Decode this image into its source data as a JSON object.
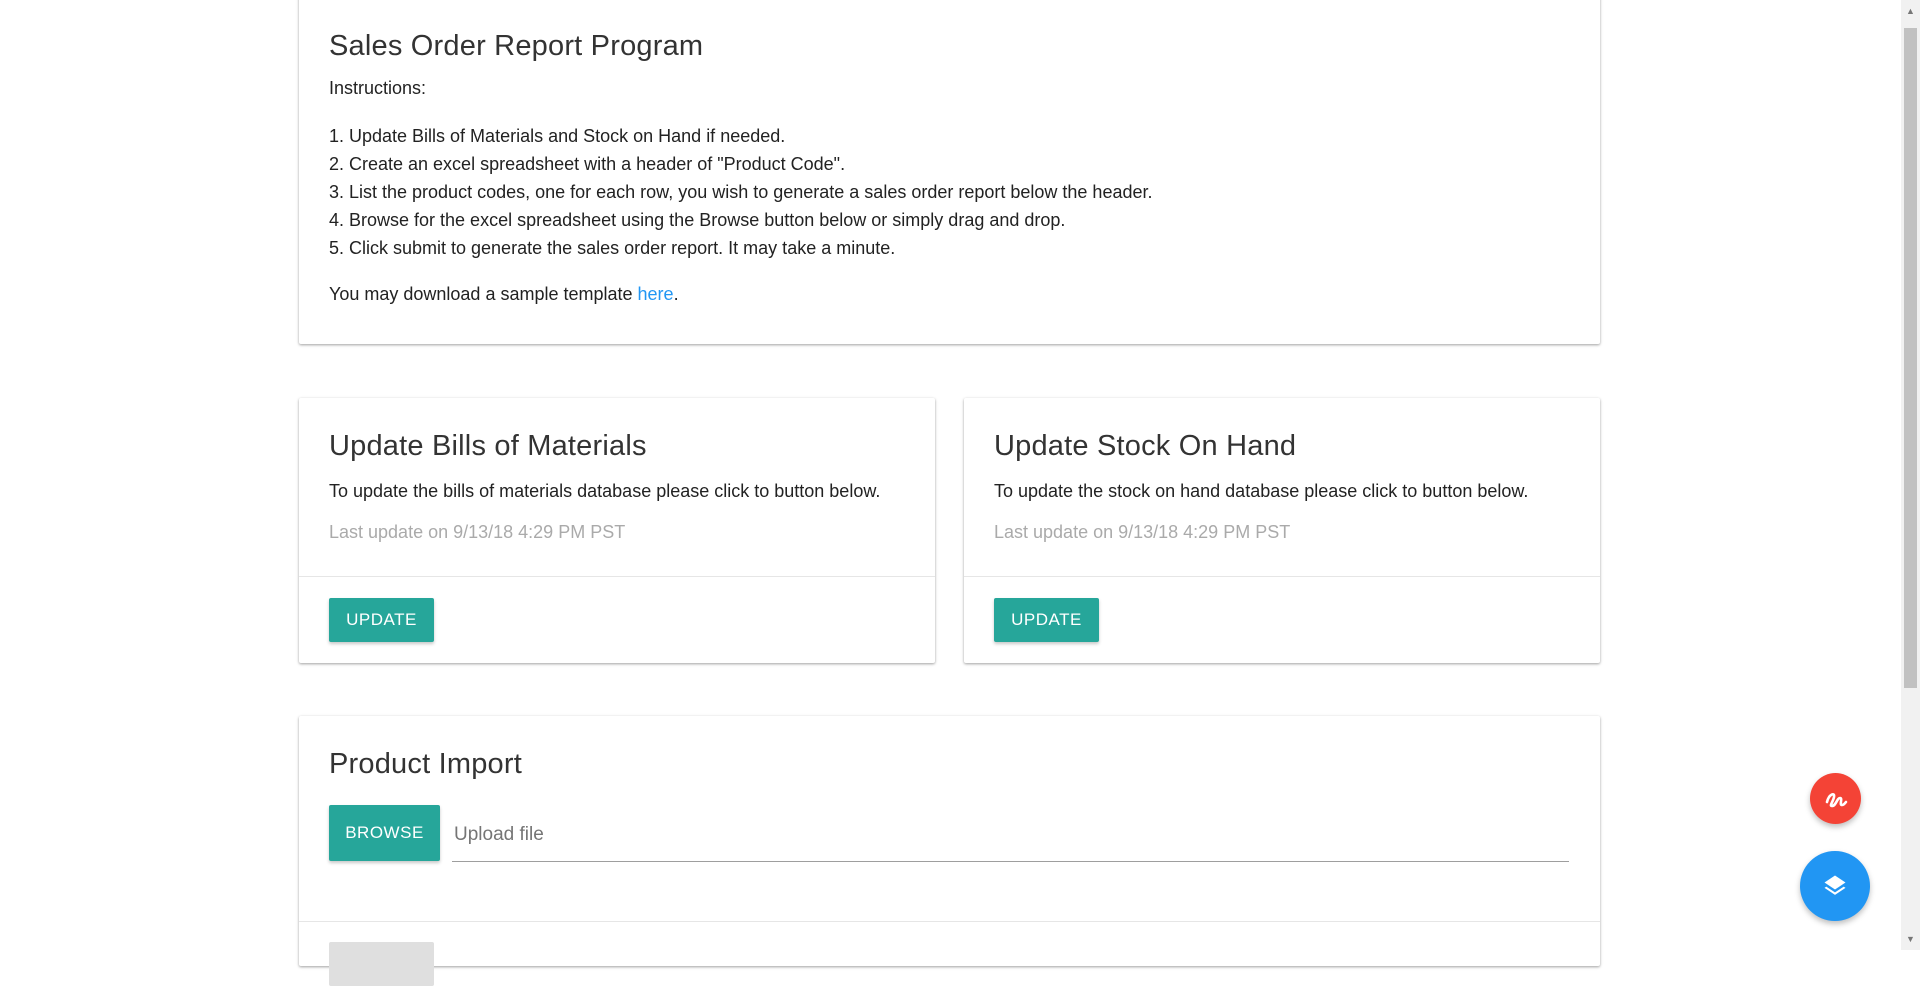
{
  "instructions_card": {
    "title": "Sales Order Report Program",
    "instructions_label": "Instructions:",
    "steps": [
      "Update Bills of Materials and Stock on Hand if needed.",
      "Create an excel spreadsheet with a header of \"Product Code\".",
      "List the product codes, one for each row, you wish to generate a sales order report below the header.",
      "Browse for the excel spreadsheet using the Browse button below or simply drag and drop.",
      "Click submit to generate the sales order report. It may take a minute."
    ],
    "download_prefix": "You may download a sample template ",
    "download_link": "here",
    "download_suffix": "."
  },
  "bom_card": {
    "title": "Update Bills of Materials",
    "description": "To update the bills of materials database please click to button below.",
    "last_update": "Last update on 9/13/18 4:29 PM PST",
    "button_label": "UPDATE"
  },
  "soh_card": {
    "title": "Update Stock On Hand",
    "description": "To update the stock on hand database please click to button below.",
    "last_update": "Last update on 9/13/18 4:29 PM PST",
    "button_label": "UPDATE"
  },
  "import_card": {
    "title": "Product Import",
    "browse_label": "BROWSE",
    "upload_placeholder": "Upload file"
  },
  "colors": {
    "accent": "#26a69a",
    "link": "#2196f3",
    "fab_red": "#f44336",
    "fab_blue": "#2196f3"
  },
  "icons": {
    "fab_top": "squiggle-icon",
    "fab_bottom": "layers-icon"
  }
}
